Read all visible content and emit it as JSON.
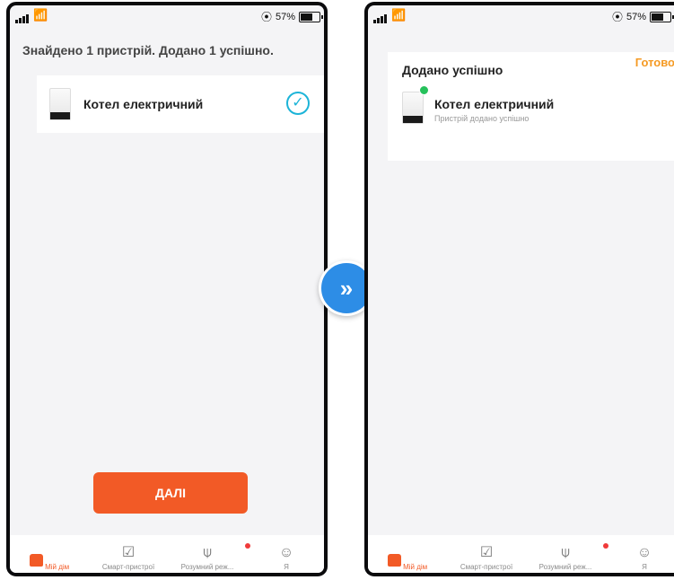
{
  "status_bar": {
    "battery_pct": "57%",
    "battery_level": 0.57,
    "wifi_icon": "wifi-icon",
    "signal_icon": "signal-icon"
  },
  "left_screen": {
    "title": "Знайдено 1 пристрій. Додано 1 успішно.",
    "device": {
      "name": "Котел електричний",
      "icon": "boiler-icon",
      "check_icon": "check-circle-icon",
      "check_glyph": "✓"
    },
    "next_button": "ДАЛІ"
  },
  "arrow": {
    "icon": "double-chevron-right-icon",
    "glyph": "»"
  },
  "right_screen": {
    "title": "Додано успішно",
    "done_link": "Готово",
    "device": {
      "name": "Котел електричний",
      "subtitle": "Пристрій додано успішно",
      "icon": "boiler-icon"
    }
  },
  "tabs": [
    {
      "label": "Мій дім",
      "icon": "home-icon",
      "active": true
    },
    {
      "label": "Смарт-пристрої",
      "icon": "checkbox-icon",
      "glyph": "☑"
    },
    {
      "label": "Розумний реж...",
      "icon": "smart-scene-icon",
      "glyph": "⍦"
    },
    {
      "label": "Я",
      "icon": "profile-icon",
      "glyph": "☺"
    }
  ],
  "colors": {
    "accent": "#f25a26",
    "check": "#1cb4d8",
    "done": "#f59a23",
    "online": "#26c15b",
    "arrow": "#2d8de6"
  }
}
